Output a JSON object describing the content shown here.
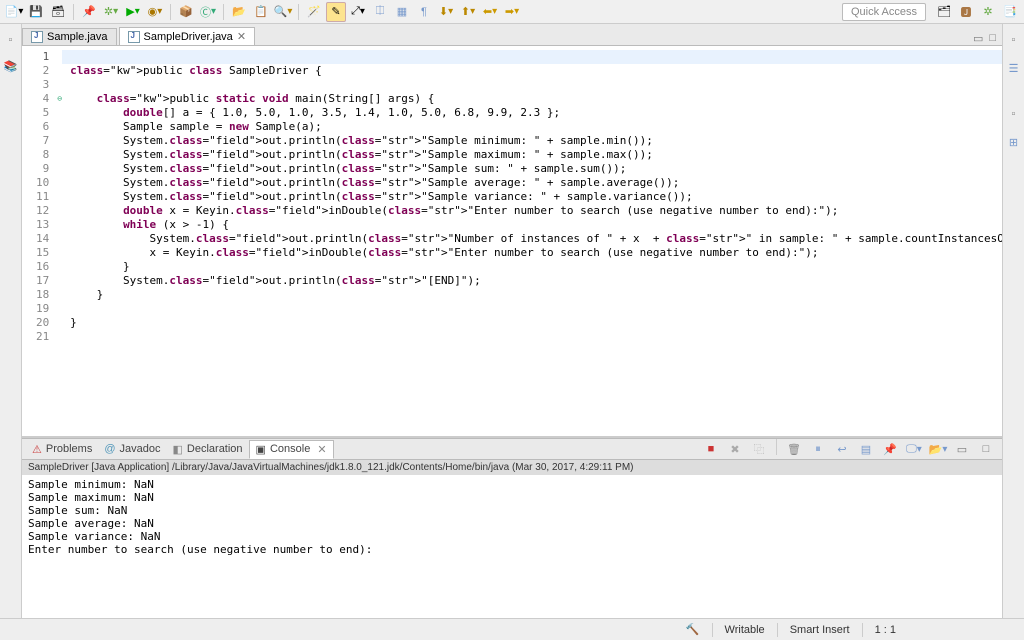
{
  "toolbar": {
    "quick_access": "Quick Access"
  },
  "tabs": [
    {
      "label": "Sample.java",
      "active": false
    },
    {
      "label": "SampleDriver.java",
      "active": true
    }
  ],
  "code": {
    "lines": [
      {
        "n": 1,
        "raw": ""
      },
      {
        "n": 2,
        "raw": "public class SampleDriver {"
      },
      {
        "n": 3,
        "raw": ""
      },
      {
        "n": 4,
        "raw": "    public static void main(String[] args) {",
        "marker": "⊖"
      },
      {
        "n": 5,
        "raw": "        double[] a = { 1.0, 5.0, 1.0, 3.5, 1.4, 1.0, 5.0, 6.8, 9.9, 2.3 };"
      },
      {
        "n": 6,
        "raw": "        Sample sample = new Sample(a);"
      },
      {
        "n": 7,
        "raw": "        System.out.println(\"Sample minimum: \" + sample.min());"
      },
      {
        "n": 8,
        "raw": "        System.out.println(\"Sample maximum: \" + sample.max());"
      },
      {
        "n": 9,
        "raw": "        System.out.println(\"Sample sum: \" + sample.sum());"
      },
      {
        "n": 10,
        "raw": "        System.out.println(\"Sample average: \" + sample.average());"
      },
      {
        "n": 11,
        "raw": "        System.out.println(\"Sample variance: \" + sample.variance());"
      },
      {
        "n": 12,
        "raw": "        double x = Keyin.inDouble(\"Enter number to search (use negative number to end):\");"
      },
      {
        "n": 13,
        "raw": "        while (x > -1) {"
      },
      {
        "n": 14,
        "raw": "            System.out.println(\"Number of instances of \" + x  + \" in sample: \" + sample.countInstancesOf(x));"
      },
      {
        "n": 15,
        "raw": "            x = Keyin.inDouble(\"Enter number to search (use negative number to end):\");"
      },
      {
        "n": 16,
        "raw": "        }"
      },
      {
        "n": 17,
        "raw": "        System.out.println(\"[END]\");"
      },
      {
        "n": 18,
        "raw": "    }"
      },
      {
        "n": 19,
        "raw": ""
      },
      {
        "n": 20,
        "raw": "}"
      },
      {
        "n": 21,
        "raw": ""
      }
    ]
  },
  "bottom_tabs": {
    "problems": "Problems",
    "javadoc": "Javadoc",
    "declaration": "Declaration",
    "console": "Console"
  },
  "console": {
    "header": "SampleDriver [Java Application] /Library/Java/JavaVirtualMachines/jdk1.8.0_121.jdk/Contents/Home/bin/java (Mar 30, 2017, 4:29:11 PM)",
    "lines": [
      "Sample minimum: NaN",
      "Sample maximum: NaN",
      "Sample sum: NaN",
      "Sample average: NaN",
      "Sample variance: NaN",
      "Enter number to search (use negative number to end):"
    ]
  },
  "status": {
    "writable": "Writable",
    "insert": "Smart Insert",
    "position": "1 : 1"
  }
}
